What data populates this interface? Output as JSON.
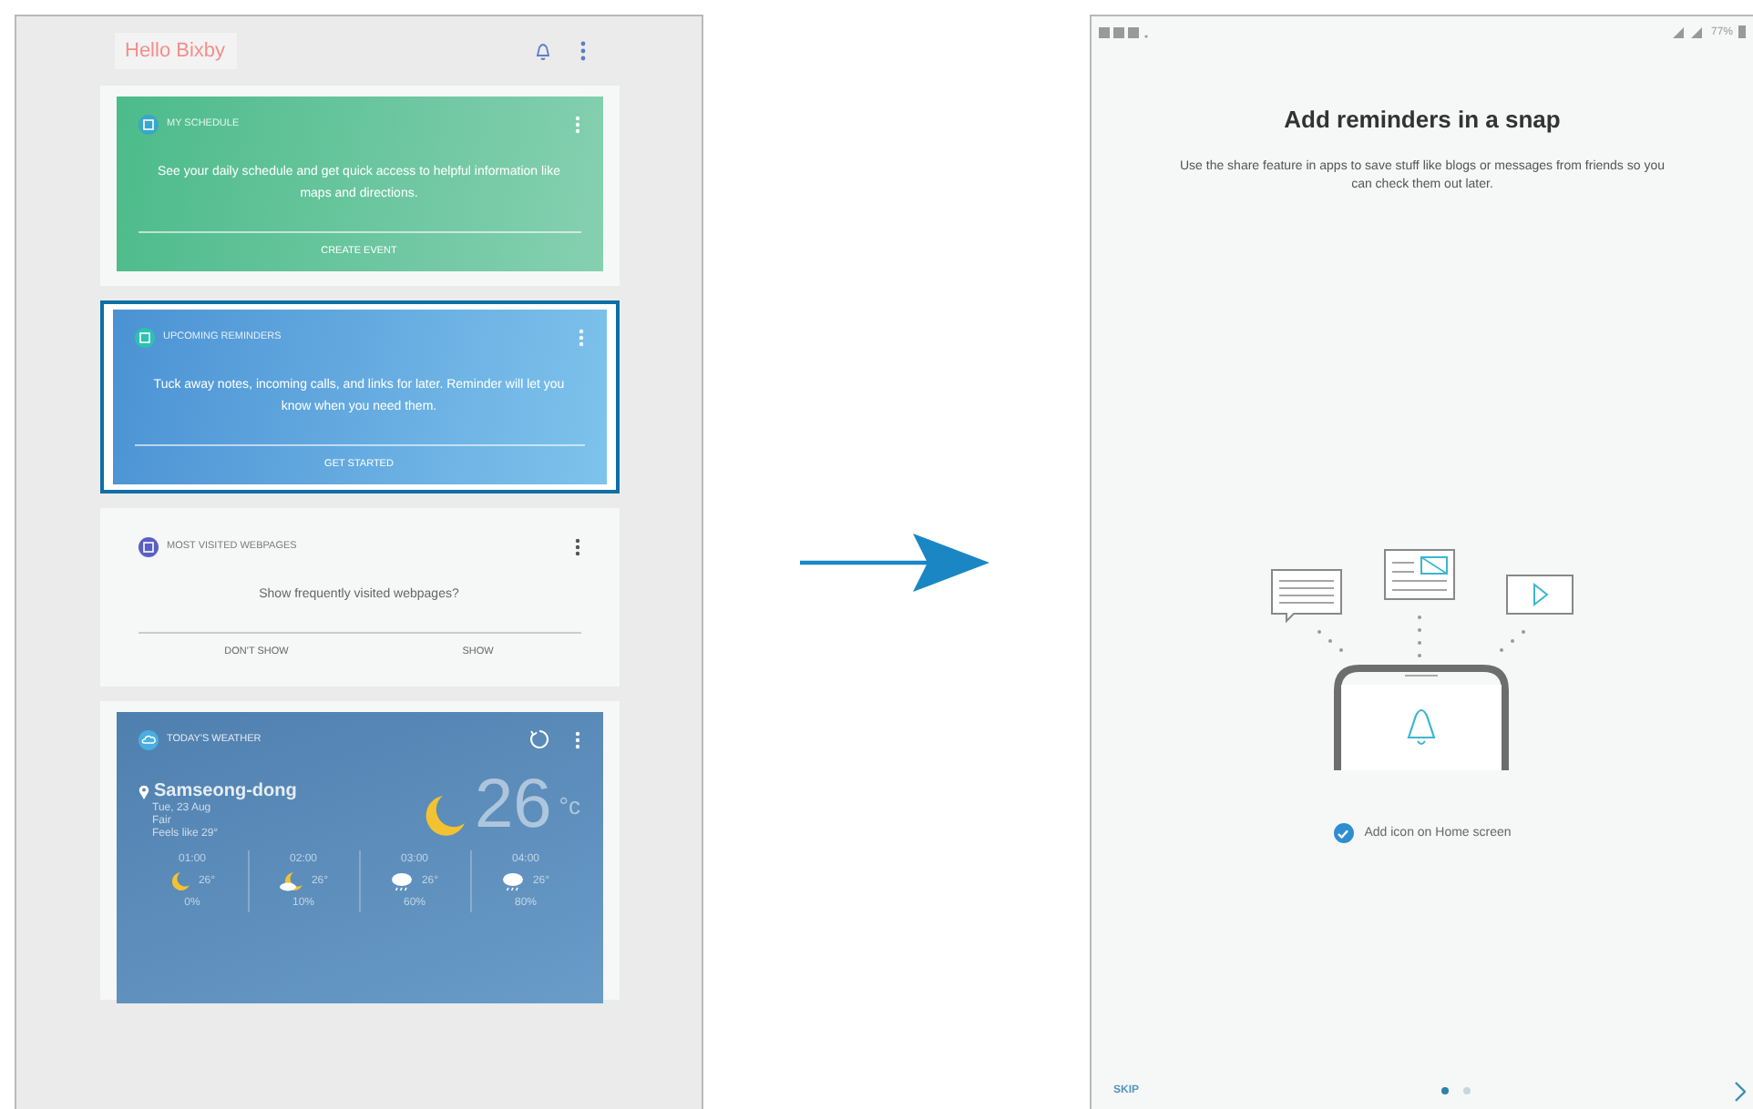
{
  "left_screen": {
    "header": {
      "title": "Hello Bixby"
    },
    "cards": [
      {
        "kind": "schedule",
        "title": "MY SCHEDULE",
        "text": "See your daily schedule and get quick access to helpful information like maps and directions.",
        "actions": [
          "CREATE EVENT"
        ],
        "selected": false
      },
      {
        "kind": "reminder",
        "title": "UPCOMING REMINDERS",
        "text": "Tuck away notes, incoming calls, and links for later. Reminder will let you know when you need them.",
        "actions": [
          "GET STARTED"
        ],
        "selected": true
      },
      {
        "kind": "web",
        "title": "MOST VISITED WEBPAGES",
        "text": "Show frequently visited webpages?",
        "actions": [
          "DON'T SHOW",
          "SHOW"
        ],
        "selected": false
      }
    ],
    "weather": {
      "title": "TODAY'S WEATHER",
      "location": "Samseong-dong",
      "date": "Tue, 23 Aug",
      "condition": "Fair",
      "feels_like": "Feels like 29°",
      "temperature": "26",
      "unit": "°c",
      "hourly": [
        {
          "time": "01:00",
          "kind": "moon",
          "temp": "26°",
          "precip": "0%"
        },
        {
          "time": "02:00",
          "kind": "moon-cloud",
          "temp": "26°",
          "precip": "10%"
        },
        {
          "time": "03:00",
          "kind": "rain",
          "temp": "26°",
          "precip": "60%"
        },
        {
          "time": "04:00",
          "kind": "rain",
          "temp": "26°",
          "precip": "80%"
        }
      ]
    }
  },
  "right_screen": {
    "status_bar": {
      "battery": "77%"
    },
    "title": "Add reminders in a snap",
    "description": "Use the share feature in apps to save stuff like blogs or messages from friends so you can check them out later.",
    "option": {
      "label": "Add icon on Home screen",
      "checked": true
    },
    "footer": {
      "skip": "SKIP",
      "pages": [
        {
          "selected": true
        },
        {
          "selected": false
        }
      ]
    }
  }
}
